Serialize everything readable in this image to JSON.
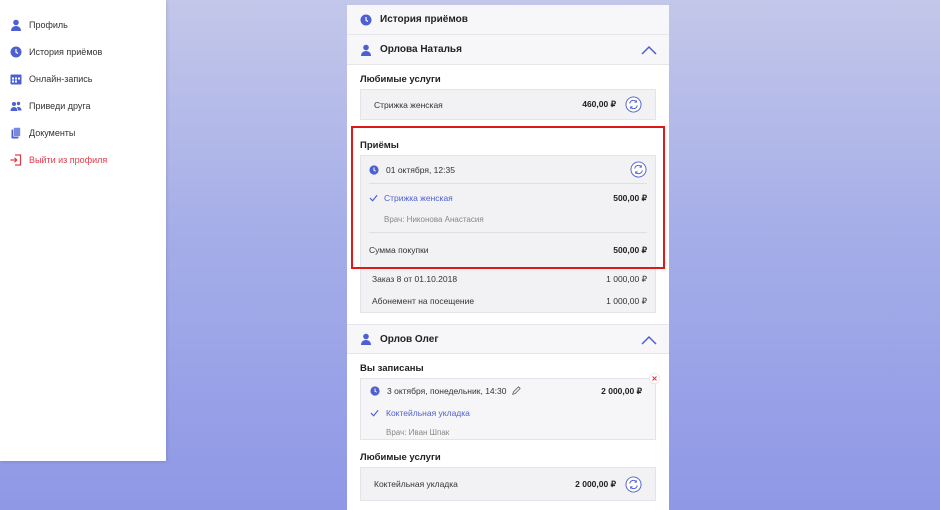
{
  "sidebar": {
    "items": [
      {
        "label": "Профиль",
        "icon": "user-icon"
      },
      {
        "label": "История приёмов",
        "icon": "clock-icon"
      },
      {
        "label": "Онлайн-запись",
        "icon": "calendar-icon"
      },
      {
        "label": "Приведи друга",
        "icon": "users-icon"
      },
      {
        "label": "Документы",
        "icon": "documents-icon"
      },
      {
        "label": "Выйти из профиля",
        "icon": "logout-icon"
      }
    ]
  },
  "main": {
    "header_title": "История приёмов",
    "person1": {
      "name": "Орлова Наталья",
      "favorites_title": "Любимые услуги",
      "favorite": {
        "name": "Стрижка женская",
        "price": "460,00 ₽"
      },
      "visits_title": "Приёмы",
      "visit": {
        "date": "01 октября, 12:35",
        "service": "Стрижка женская",
        "service_price": "500,00 ₽",
        "doctor": "Врач: Никонова Анастасия",
        "total_label": "Сумма покупки",
        "total_price": "500,00 ₽"
      },
      "orders": [
        {
          "label": "Заказ 8 от 01.10.2018",
          "price": "1 000,00 ₽"
        },
        {
          "label": "Абонемент на посещение",
          "price": "1 000,00 ₽"
        }
      ]
    },
    "person2": {
      "name": "Орлов Олег",
      "booked_title": "Вы записаны",
      "booking": {
        "date": "3 октября, понедельник, 14:30",
        "price": "2 000,00 ₽",
        "service": "Коктейльная укладка",
        "doctor": "Врач: Иван Шпак"
      },
      "favorites_title": "Любимые услуги",
      "favorite": {
        "name": "Коктейльная укладка",
        "price": "2 000,00 ₽"
      }
    }
  },
  "colors": {
    "accent": "#4d5fd1",
    "danger": "#e53a4a",
    "highlight": "#e01818"
  }
}
